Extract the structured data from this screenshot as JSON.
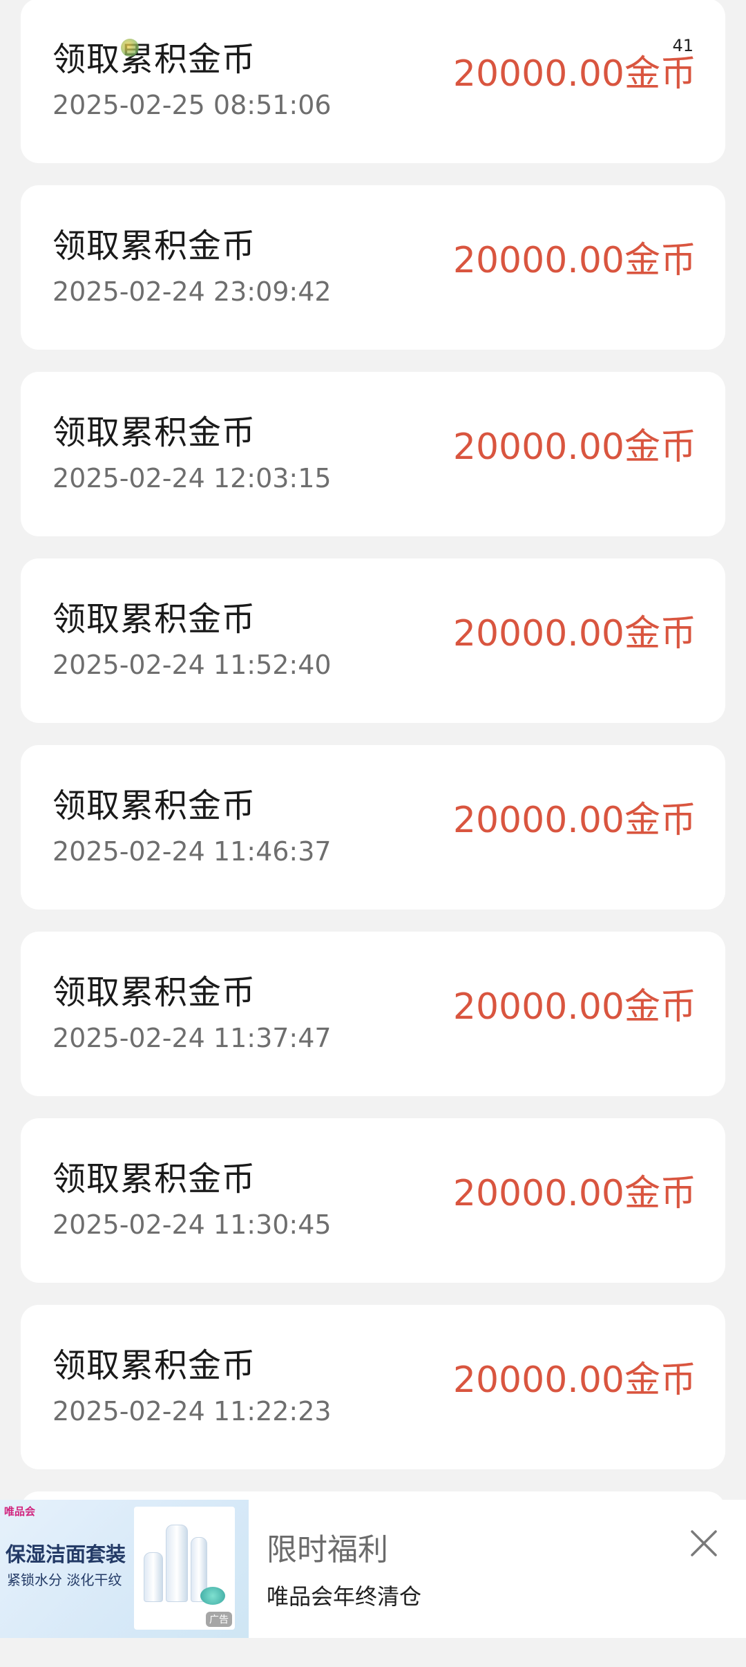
{
  "status_bar": {
    "right_text": "41"
  },
  "records": [
    {
      "title": "领取累积金币",
      "time": "2025-02-25 08:51:06",
      "amount": "20000.00金币"
    },
    {
      "title": "领取累积金币",
      "time": "2025-02-24 23:09:42",
      "amount": "20000.00金币"
    },
    {
      "title": "领取累积金币",
      "time": "2025-02-24 12:03:15",
      "amount": "20000.00金币"
    },
    {
      "title": "领取累积金币",
      "time": "2025-02-24 11:52:40",
      "amount": "20000.00金币"
    },
    {
      "title": "领取累积金币",
      "time": "2025-02-24 11:46:37",
      "amount": "20000.00金币"
    },
    {
      "title": "领取累积金币",
      "time": "2025-02-24 11:37:47",
      "amount": "20000.00金币"
    },
    {
      "title": "领取累积金币",
      "time": "2025-02-24 11:30:45",
      "amount": "20000.00金币"
    },
    {
      "title": "领取累积金币",
      "time": "2025-02-24 11:22:23",
      "amount": "20000.00金币"
    }
  ],
  "ad": {
    "brand": "唯品会",
    "image_headline": "保湿洁面套装",
    "image_subline": "紧锁水分 淡化干纹",
    "image_tag": "广告",
    "title": "限时福利",
    "subtitle": "唯品会年终清仓",
    "close_icon": "close-icon"
  },
  "colors": {
    "amount": "#d9553f",
    "background": "#f2f2f2",
    "card": "#ffffff"
  }
}
